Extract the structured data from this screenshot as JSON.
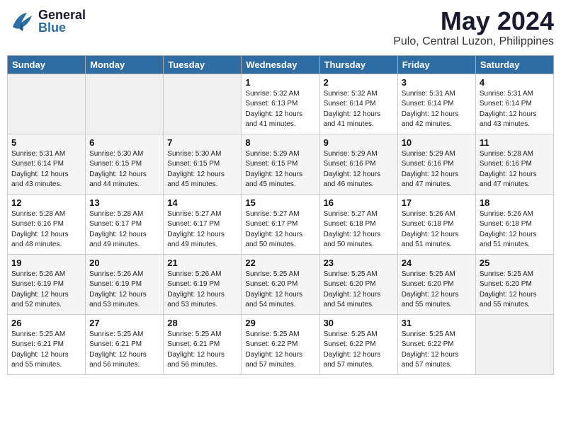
{
  "header": {
    "logo_general": "General",
    "logo_blue": "Blue",
    "month_title": "May 2024",
    "location": "Pulo, Central Luzon, Philippines"
  },
  "days_of_week": [
    "Sunday",
    "Monday",
    "Tuesday",
    "Wednesday",
    "Thursday",
    "Friday",
    "Saturday"
  ],
  "weeks": [
    [
      {
        "num": "",
        "info": ""
      },
      {
        "num": "",
        "info": ""
      },
      {
        "num": "",
        "info": ""
      },
      {
        "num": "1",
        "info": "Sunrise: 5:32 AM\nSunset: 6:13 PM\nDaylight: 12 hours\nand 41 minutes."
      },
      {
        "num": "2",
        "info": "Sunrise: 5:32 AM\nSunset: 6:14 PM\nDaylight: 12 hours\nand 41 minutes."
      },
      {
        "num": "3",
        "info": "Sunrise: 5:31 AM\nSunset: 6:14 PM\nDaylight: 12 hours\nand 42 minutes."
      },
      {
        "num": "4",
        "info": "Sunrise: 5:31 AM\nSunset: 6:14 PM\nDaylight: 12 hours\nand 43 minutes."
      }
    ],
    [
      {
        "num": "5",
        "info": "Sunrise: 5:31 AM\nSunset: 6:14 PM\nDaylight: 12 hours\nand 43 minutes."
      },
      {
        "num": "6",
        "info": "Sunrise: 5:30 AM\nSunset: 6:15 PM\nDaylight: 12 hours\nand 44 minutes."
      },
      {
        "num": "7",
        "info": "Sunrise: 5:30 AM\nSunset: 6:15 PM\nDaylight: 12 hours\nand 45 minutes."
      },
      {
        "num": "8",
        "info": "Sunrise: 5:29 AM\nSunset: 6:15 PM\nDaylight: 12 hours\nand 45 minutes."
      },
      {
        "num": "9",
        "info": "Sunrise: 5:29 AM\nSunset: 6:16 PM\nDaylight: 12 hours\nand 46 minutes."
      },
      {
        "num": "10",
        "info": "Sunrise: 5:29 AM\nSunset: 6:16 PM\nDaylight: 12 hours\nand 47 minutes."
      },
      {
        "num": "11",
        "info": "Sunrise: 5:28 AM\nSunset: 6:16 PM\nDaylight: 12 hours\nand 47 minutes."
      }
    ],
    [
      {
        "num": "12",
        "info": "Sunrise: 5:28 AM\nSunset: 6:16 PM\nDaylight: 12 hours\nand 48 minutes."
      },
      {
        "num": "13",
        "info": "Sunrise: 5:28 AM\nSunset: 6:17 PM\nDaylight: 12 hours\nand 49 minutes."
      },
      {
        "num": "14",
        "info": "Sunrise: 5:27 AM\nSunset: 6:17 PM\nDaylight: 12 hours\nand 49 minutes."
      },
      {
        "num": "15",
        "info": "Sunrise: 5:27 AM\nSunset: 6:17 PM\nDaylight: 12 hours\nand 50 minutes."
      },
      {
        "num": "16",
        "info": "Sunrise: 5:27 AM\nSunset: 6:18 PM\nDaylight: 12 hours\nand 50 minutes."
      },
      {
        "num": "17",
        "info": "Sunrise: 5:26 AM\nSunset: 6:18 PM\nDaylight: 12 hours\nand 51 minutes."
      },
      {
        "num": "18",
        "info": "Sunrise: 5:26 AM\nSunset: 6:18 PM\nDaylight: 12 hours\nand 51 minutes."
      }
    ],
    [
      {
        "num": "19",
        "info": "Sunrise: 5:26 AM\nSunset: 6:19 PM\nDaylight: 12 hours\nand 52 minutes."
      },
      {
        "num": "20",
        "info": "Sunrise: 5:26 AM\nSunset: 6:19 PM\nDaylight: 12 hours\nand 53 minutes."
      },
      {
        "num": "21",
        "info": "Sunrise: 5:26 AM\nSunset: 6:19 PM\nDaylight: 12 hours\nand 53 minutes."
      },
      {
        "num": "22",
        "info": "Sunrise: 5:25 AM\nSunset: 6:20 PM\nDaylight: 12 hours\nand 54 minutes."
      },
      {
        "num": "23",
        "info": "Sunrise: 5:25 AM\nSunset: 6:20 PM\nDaylight: 12 hours\nand 54 minutes."
      },
      {
        "num": "24",
        "info": "Sunrise: 5:25 AM\nSunset: 6:20 PM\nDaylight: 12 hours\nand 55 minutes."
      },
      {
        "num": "25",
        "info": "Sunrise: 5:25 AM\nSunset: 6:20 PM\nDaylight: 12 hours\nand 55 minutes."
      }
    ],
    [
      {
        "num": "26",
        "info": "Sunrise: 5:25 AM\nSunset: 6:21 PM\nDaylight: 12 hours\nand 55 minutes."
      },
      {
        "num": "27",
        "info": "Sunrise: 5:25 AM\nSunset: 6:21 PM\nDaylight: 12 hours\nand 56 minutes."
      },
      {
        "num": "28",
        "info": "Sunrise: 5:25 AM\nSunset: 6:21 PM\nDaylight: 12 hours\nand 56 minutes."
      },
      {
        "num": "29",
        "info": "Sunrise: 5:25 AM\nSunset: 6:22 PM\nDaylight: 12 hours\nand 57 minutes."
      },
      {
        "num": "30",
        "info": "Sunrise: 5:25 AM\nSunset: 6:22 PM\nDaylight: 12 hours\nand 57 minutes."
      },
      {
        "num": "31",
        "info": "Sunrise: 5:25 AM\nSunset: 6:22 PM\nDaylight: 12 hours\nand 57 minutes."
      },
      {
        "num": "",
        "info": ""
      }
    ]
  ]
}
